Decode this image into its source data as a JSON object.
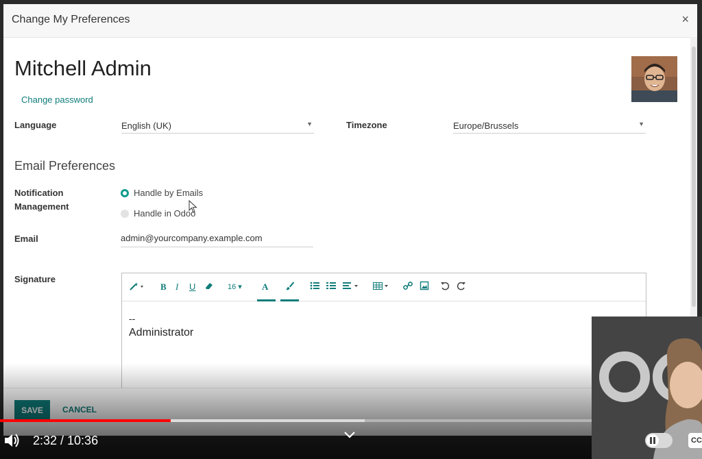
{
  "dialog": {
    "title": "Change My Preferences",
    "close_symbol": "×"
  },
  "user": {
    "name": "Mitchell Admin",
    "change_password": "Change password"
  },
  "fields": {
    "language_label": "Language",
    "language_value": "English (UK)",
    "timezone_label": "Timezone",
    "timezone_value": "Europe/Brussels",
    "email_prefs_title": "Email Preferences",
    "notification_label_1": "Notification",
    "notification_label_2": "Management",
    "notification_options": [
      "Handle by Emails",
      "Handle in Odoo"
    ],
    "notification_selected": "Handle by Emails",
    "email_label": "Email",
    "email_value": "admin@yourcompany.example.com",
    "signature_label": "Signature"
  },
  "editor": {
    "font_size": "16",
    "signature_line1": "--",
    "signature_line2": "Administrator"
  },
  "footer": {
    "save": "SAVE",
    "cancel": "CANCEL"
  },
  "player": {
    "time": "2:32 / 10:36",
    "played_fraction": 0.243,
    "buffered_fraction": 0.52,
    "accent_color": "#ff0000",
    "cc_label": "CC"
  },
  "colors": {
    "brand": "#0f7c7a",
    "radio_accent": "#0f9b8e"
  }
}
